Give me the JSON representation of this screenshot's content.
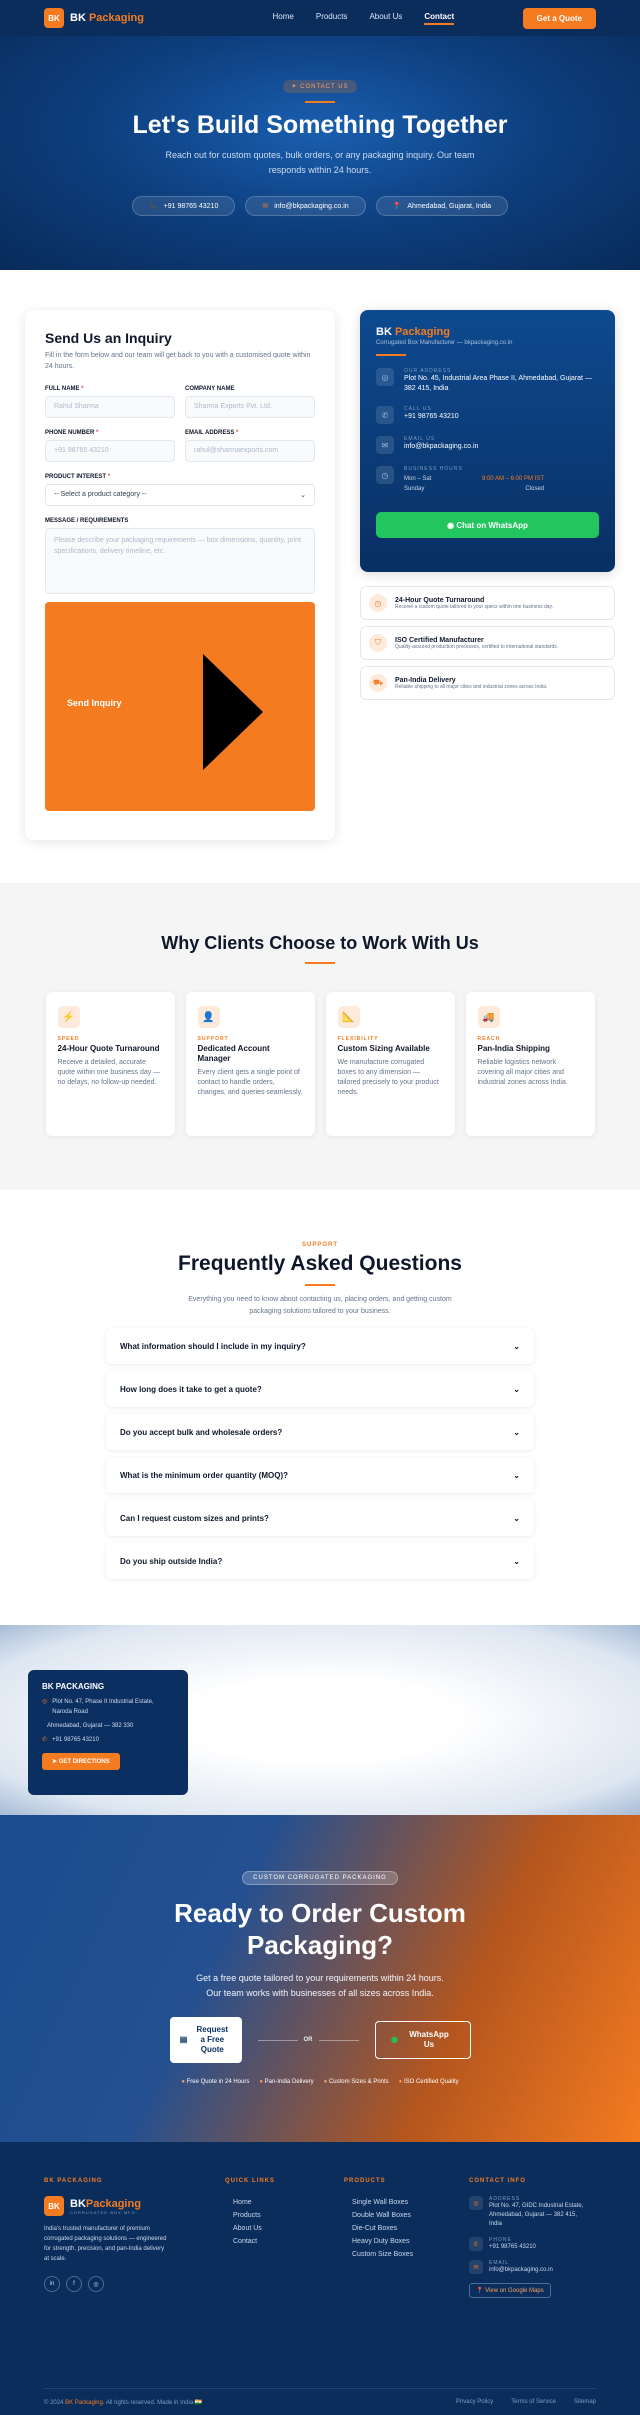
{
  "nav": {
    "logo_mark": "BK",
    "logo_brand": "BK",
    "logo_accent": "Packaging",
    "links": [
      "Home",
      "Products",
      "About Us",
      "Contact"
    ],
    "active": "Contact",
    "cta": "Get a Quote"
  },
  "hero": {
    "pill": "✦ CONTACT US",
    "title": "Let's Build Something Together",
    "subtitle": "Reach out for custom quotes, bulk orders, or any packaging inquiry. Our team responds within 24 hours.",
    "phone": "+91 98765 43210",
    "email": "info@bkpackaging.co.in",
    "location": "Ahmedabad, Gujarat, India"
  },
  "form": {
    "title": "Send Us an Inquiry",
    "subtitle": "Fill in the form below and our team will get back to you with a customised quote within 24 hours.",
    "full_name_label": "FULL NAME",
    "full_name_placeholder": "Rahul Sharma",
    "company_label": "COMPANY NAME",
    "company_placeholder": "Sharma Exports Pvt. Ltd.",
    "phone_label": "PHONE NUMBER",
    "phone_placeholder": "+91 98765 43210",
    "email_label": "EMAIL ADDRESS",
    "email_placeholder": "rahul@sharmaexports.com",
    "product_label": "PRODUCT INTEREST",
    "product_value": "-- Select a product category --",
    "message_label": "MESSAGE / REQUIREMENTS",
    "message_placeholder": "Please describe your packaging requirements — box dimensions, quantity, print specifications, delivery timeline, etc.",
    "submit": "Send Inquiry"
  },
  "contact_card": {
    "brand": "BK",
    "brand_accent": "Packaging",
    "tagline": "Corrugated Box Manufacturer — bkpackaging.co.in",
    "addr_label": "OUR ADDRESS",
    "addr": "Plot No. 45, Industrial Area Phase II, Ahmedabad, Gujarat — 382 415, India",
    "call_label": "CALL US",
    "call": "+91 98765 43210",
    "email_label": "EMAIL US",
    "email": "info@bkpackaging.co.in",
    "hours_label": "BUSINESS HOURS",
    "hours": "Mon – Sat",
    "hours_time": "9:00 AM – 6:00 PM IST",
    "sunday": "Sunday",
    "closed": "Closed",
    "whatsapp": "Chat on WhatsApp"
  },
  "features": [
    {
      "title": "24-Hour Quote Turnaround",
      "desc": "Receive a custom quote tailored to your specs within one business day."
    },
    {
      "title": "ISO Certified Manufacturer",
      "desc": "Quality-assured production processes, certified to international standards."
    },
    {
      "title": "Pan-India Delivery",
      "desc": "Reliable shipping to all major cities and industrial zones across India."
    }
  ],
  "why": {
    "title": "Why Clients Choose to Work With Us",
    "cards": [
      {
        "tag": "SPEED",
        "title": "24-Hour Quote Turnaround",
        "desc": "Receive a detailed, accurate quote within one business day — no delays, no follow-up needed."
      },
      {
        "tag": "SUPPORT",
        "title": "Dedicated Account Manager",
        "desc": "Every client gets a single point of contact to handle orders, changes, and queries seamlessly."
      },
      {
        "tag": "FLEXIBILITY",
        "title": "Custom Sizing Available",
        "desc": "We manufacture corrugated boxes to any dimension — tailored precisely to your product needs."
      },
      {
        "tag": "REACH",
        "title": "Pan-India Shipping",
        "desc": "Reliable logistics network covering all major cities and industrial zones across India."
      }
    ]
  },
  "faq": {
    "eyebrow": "SUPPORT",
    "title": "Frequently Asked Questions",
    "subtitle": "Everything you need to know about contacting us, placing orders, and getting custom packaging solutions tailored to your business.",
    "items": [
      "What information should I include in my inquiry?",
      "How long does it take to get a quote?",
      "Do you accept bulk and wholesale orders?",
      "What is the minimum order quantity (MOQ)?",
      "Can I request custom sizes and prints?",
      "Do you ship outside India?"
    ]
  },
  "map": {
    "title": "BK PACKAGING",
    "addr1": "Plot No. 47, Phase II Industrial Estate, Naroda Road",
    "addr2": "Ahmedabad, Gujarat — 382 330",
    "phone": "+91 98765 43210",
    "directions": "GET DIRECTIONS"
  },
  "cta": {
    "pill": "CUSTOM CORRUGATED PACKAGING",
    "title": "Ready to Order Custom Packaging?",
    "line1": "Get a free quote tailored to your requirements within 24 hours.",
    "line2": "Our team works with businesses of all sizes across India.",
    "btn1": "Request a Free Quote",
    "or": "OR",
    "btn2": "WhatsApp Us",
    "ticks": [
      "Free Quote in 24 Hours",
      "Pan-India Delivery",
      "Custom Sizes & Prints",
      "ISO Certified Quality"
    ]
  },
  "footer": {
    "c1_head": "BK PACKAGING",
    "brand": "BK",
    "brand_accent": "Packaging",
    "brand_sub": "CORRUGATED BOX MFG.",
    "desc": "India's trusted manufacturer of premium corrugated packaging solutions — engineered for strength, precision, and pan-India delivery at scale.",
    "social": [
      "in",
      "f",
      "◎"
    ],
    "c2_head": "QUICK LINKS",
    "quick": [
      "Home",
      "Products",
      "About Us",
      "Contact"
    ],
    "c3_head": "PRODUCTS",
    "products": [
      "Single Wall Boxes",
      "Double Wall Boxes",
      "Die-Cut Boxes",
      "Heavy Duty Boxes",
      "Custom Size Boxes"
    ],
    "c4_head": "CONTACT INFO",
    "addr_label": "ADDRESS",
    "addr": "Plot No. 47, GIDC Industrial Estate, Ahmedabad, Gujarat — 382 415, India",
    "phone_label": "PHONE",
    "phone": "+91 98765 43210",
    "email_label": "EMAIL",
    "email": "info@bkpackaging.co.in",
    "maps": "📍 View on Google Maps",
    "copy_pre": "© 2024",
    "copy_brand": "BK Packaging",
    "copy_post": ". All rights reserved. Made in India 🇮🇳",
    "legal": [
      "Privacy Policy",
      "Terms of Service",
      "Sitemap"
    ]
  }
}
